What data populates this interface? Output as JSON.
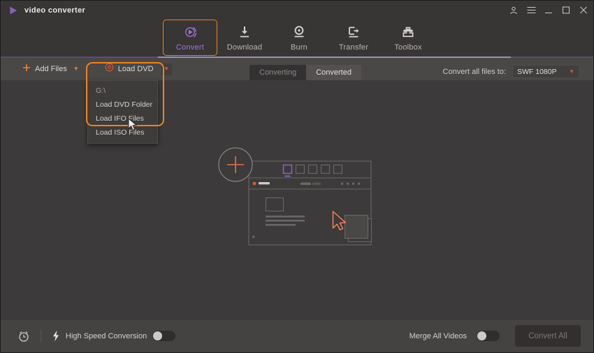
{
  "window": {
    "title": "video converter",
    "logo_icon": "play-triangle-icon",
    "controls": [
      {
        "name": "account-icon",
        "glyph": "account"
      },
      {
        "name": "menu-icon",
        "glyph": "hamburger"
      },
      {
        "name": "minimize-icon",
        "glyph": "minimize"
      },
      {
        "name": "maximize-icon",
        "glyph": "maximize"
      },
      {
        "name": "close-icon",
        "glyph": "close"
      }
    ]
  },
  "nav": {
    "items": [
      {
        "label": "Convert",
        "icon": "convert-icon",
        "active": true
      },
      {
        "label": "Download",
        "icon": "download-icon",
        "active": false
      },
      {
        "label": "Burn",
        "icon": "burn-icon",
        "active": false
      },
      {
        "label": "Transfer",
        "icon": "transfer-icon",
        "active": false
      },
      {
        "label": "Toolbox",
        "icon": "toolbox-icon",
        "active": false
      }
    ]
  },
  "toolbar": {
    "add_files_label": "Add Files",
    "add_files_icon": "plus-icon",
    "load_dvd_label": "Load DVD",
    "load_dvd_icon": "disc-icon",
    "caret_glyph": "▼",
    "tabs": [
      {
        "label": "Converting",
        "active": true
      },
      {
        "label": "Converted",
        "active": false
      }
    ],
    "convert_all_to_label": "Convert all files to:",
    "convert_all_to_value": "SWF 1080P"
  },
  "dvd_menu": {
    "items": [
      {
        "label": "G:\\",
        "dim": true
      },
      {
        "label": "Load DVD Folder",
        "dim": false
      },
      {
        "label": "Load IFO Files",
        "dim": false
      },
      {
        "label": "Load ISO Files",
        "dim": false
      }
    ]
  },
  "bottom_bar": {
    "timer_icon": "alarm-clock-icon",
    "bolt_icon": "lightning-bolt-icon",
    "high_speed_label": "High Speed Conversion",
    "high_speed_on": false,
    "merge_label": "Merge All Videos",
    "merge_on": false,
    "convert_all_button": "Convert All"
  },
  "colors": {
    "accent_orange": "#f0821e",
    "accent_purple": "#a673d8",
    "disc_red": "#e0562c",
    "titlebar_bg": "#383535",
    "toolbar_bg": "#4a4747",
    "canvas_bg": "#3c3a3a",
    "bottombar_bg": "#454242",
    "underline_purple": "#5b4a78"
  }
}
